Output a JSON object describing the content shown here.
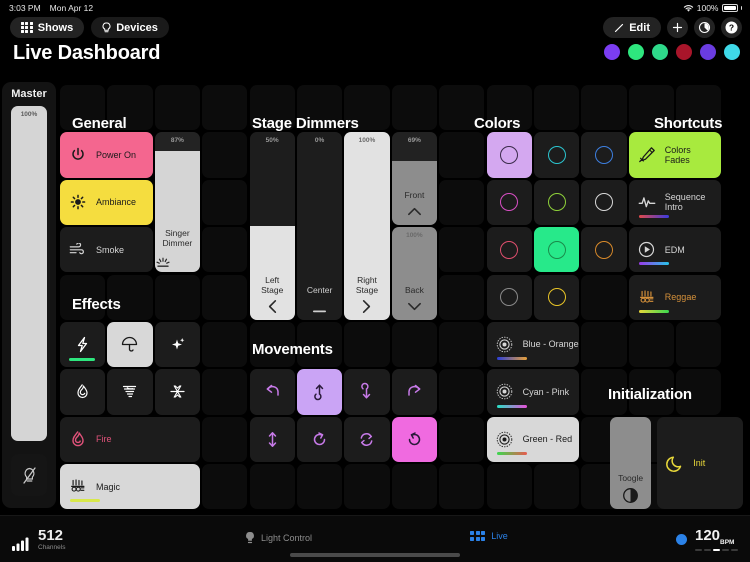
{
  "status_bar": {
    "time": "3:03 PM",
    "date": "Mon Apr 12",
    "battery": "100%",
    "wifi_icon": "wifi-icon",
    "battery_icon": "battery-icon"
  },
  "top_bar": {
    "shows_label": "Shows",
    "devices_label": "Devices",
    "edit_label": "Edit",
    "add_label": "+",
    "timer_label": "◔",
    "help_label": "?"
  },
  "page_title": "Live Dashboard",
  "color_dots": [
    "#7b3df2",
    "#2ee67e",
    "#2ed98a",
    "#a8152a",
    "#6a3ce0",
    "#3fd9e8"
  ],
  "master": {
    "title": "Master",
    "percent": "100%",
    "value": 100,
    "blackout_icon": "bulb-off-icon"
  },
  "sections": {
    "general": "General",
    "effects": "Effects",
    "stage_dimmers": "Stage Dimmers",
    "movements": "Movements",
    "colors": "Colors",
    "shortcuts": "Shortcuts",
    "initialization": "Initialization"
  },
  "general_buttons": [
    {
      "label": "Power On",
      "icon": "power-icon",
      "style": "pink",
      "bg": "#f4668f",
      "fg": "#1a1a1a"
    },
    {
      "label": "Ambiance",
      "icon": "sun-icon",
      "style": "yellow",
      "bg": "#f5dd3f",
      "fg": "#1a1a1a"
    },
    {
      "label": "Smoke",
      "icon": "smoke-icon",
      "style": "dark",
      "bg": "#1c1c1c",
      "fg": "#d6d6d6"
    }
  ],
  "singer_dimmer": {
    "label": "Singer\nDimmer",
    "label1": "Singer",
    "label2": "Dimmer",
    "percent": "87%",
    "value": 87,
    "icon": "dimmer-icon"
  },
  "effects_small": [
    {
      "icon": "lightning-icon",
      "active": false,
      "bar": "#2ee67e",
      "color": "#ffffff"
    },
    {
      "icon": "umbrella-icon",
      "active": true,
      "bar": "",
      "color": "#1a1a1a"
    },
    {
      "icon": "sparkles-icon",
      "active": false,
      "bar": "",
      "color": "#ffffff"
    },
    {
      "icon": "flame-outline-icon",
      "active": false,
      "bar": "",
      "color": "#ffffff"
    },
    {
      "icon": "tornado-icon",
      "active": false,
      "bar": "",
      "color": "#ffffff"
    },
    {
      "icon": "snowflake-icon",
      "active": false,
      "bar": "",
      "color": "#ffffff"
    }
  ],
  "effects_wide": [
    {
      "label": "Fire",
      "icon": "flame-icon",
      "active": false,
      "fg": "#e0527a",
      "bar": ""
    },
    {
      "label": "Magic",
      "icon": "magic-icon",
      "active": true,
      "fg": "#1a1a1a",
      "bar": "#d8e84a"
    }
  ],
  "stage_dimmers": [
    {
      "label": "Left Stage",
      "label1": "Left",
      "label2": "Stage",
      "percent": "50%",
      "value": 50,
      "icon": "chevron-left-icon",
      "type": "tall"
    },
    {
      "label": "Center",
      "label1": "Center",
      "label2": "",
      "percent": "0%",
      "value": 0,
      "icon": "dash-icon",
      "type": "tall"
    },
    {
      "label": "Right Stage",
      "label1": "Right",
      "label2": "Stage",
      "percent": "100%",
      "value": 100,
      "icon": "chevron-right-icon",
      "type": "tall"
    },
    {
      "label": "Front",
      "label1": "Front",
      "label2": "",
      "percent": "69%",
      "value": 69,
      "icon": "chevron-up-icon",
      "type": "short"
    },
    {
      "label": "Back",
      "label1": "Back",
      "label2": "",
      "percent": "100%",
      "value": 100,
      "icon": "chevron-down-icon",
      "type": "short"
    }
  ],
  "movements": [
    {
      "icon": "arrow-undo-icon",
      "active": false
    },
    {
      "icon": "arrow-up-curve-icon",
      "active": true,
      "bg": "#caa4f5"
    },
    {
      "icon": "arrow-down-curve-icon",
      "active": false
    },
    {
      "icon": "arrow-redo-icon",
      "active": false
    },
    {
      "icon": "arrow-updown-icon",
      "active": false
    },
    {
      "icon": "rotate-cw-icon",
      "active": false
    },
    {
      "icon": "sync-icon",
      "active": false
    },
    {
      "icon": "rotate-ccw-icon",
      "active": true,
      "bg": "#f06ae0"
    }
  ],
  "color_swatches": [
    {
      "name": "purple",
      "ring": "#3a2a4a",
      "active": true,
      "bg": "#d4a8f0"
    },
    {
      "name": "cyan",
      "ring": "#2bc4cf",
      "active": false,
      "bg": "#1c1c1c"
    },
    {
      "name": "blue",
      "ring": "#3d7fe0",
      "active": false,
      "bg": "#1c1c1c"
    },
    {
      "name": "magenta",
      "ring": "#d84fc4",
      "active": false,
      "bg": "#1c1c1c"
    },
    {
      "name": "lime",
      "ring": "#8ed13a",
      "active": false,
      "bg": "#1c1c1c"
    },
    {
      "name": "white",
      "ring": "#d8d8d8",
      "active": false,
      "bg": "#1c1c1c"
    },
    {
      "name": "rose",
      "ring": "#e04f6e",
      "active": false,
      "bg": "#1c1c1c"
    },
    {
      "name": "green",
      "ring": "#1a8a4a",
      "active": true,
      "bg": "#27e98a"
    },
    {
      "name": "orange",
      "ring": "#d98a2a",
      "active": false,
      "bg": "#1c1c1c"
    },
    {
      "name": "grey",
      "ring": "#8a8a8a",
      "active": false,
      "bg": "#1c1c1c"
    },
    {
      "name": "yellow",
      "ring": "#e8c427",
      "active": false,
      "bg": "#1c1c1c"
    }
  ],
  "color_presets": [
    {
      "label": "Blue - Orange",
      "icon": "target-icon",
      "active": false,
      "from": "#2b3fd8",
      "to": "#e8a13a"
    },
    {
      "label": "Cyan - Pink",
      "icon": "target-icon",
      "active": false,
      "from": "#27e0c4",
      "to": "#e84fd8"
    },
    {
      "label": "Green - Red",
      "icon": "target-icon",
      "active": true,
      "from": "#3ad84f",
      "to": "#e85a4f"
    }
  ],
  "shortcuts": [
    {
      "label": "Colors Fades",
      "label1": "Colors",
      "label2": "Fades",
      "icon": "brush-icon",
      "active": true,
      "bg": "#a8ea3e",
      "fg": "#1a1a1a",
      "from": "",
      "to": ""
    },
    {
      "label": "Sequence Intro",
      "label1": "Sequence",
      "label2": "Intro",
      "icon": "pulse-icon",
      "active": false,
      "bg": "#1c1c1c",
      "fg": "#d6d6d6",
      "from": "#e04a4a",
      "to": "#3a3ae0"
    },
    {
      "label": "EDM",
      "label1": "EDM",
      "label2": "",
      "icon": "play-circle-icon",
      "active": false,
      "bg": "#1c1c1c",
      "fg": "#d6d6d6",
      "from": "#9a3ae8",
      "to": "#27c4e8"
    },
    {
      "label": "Reggae",
      "label1": "Reggae",
      "label2": "",
      "icon": "magic-icon",
      "active": false,
      "bg": "#1c1c1c",
      "fg": "#d4903a",
      "from": "#e8d83a",
      "to": "#3ad84f"
    }
  ],
  "initialization": {
    "toggle": {
      "label": "Toogle",
      "icon": "contrast-icon"
    },
    "init": {
      "label": "Init",
      "icon": "moon-icon",
      "fg": "#e8d83a"
    }
  },
  "bottom_bar": {
    "channels_value": "512",
    "channels_label": "Channels",
    "signal_icon": "signal-icon",
    "light_control": "Light Control",
    "light_control_icon": "bulb-icon",
    "live": "Live",
    "live_icon": "grid-icon",
    "bpm_value": "120",
    "bpm_unit": "BPM",
    "bpm_dot_color": "#2b82e8"
  }
}
